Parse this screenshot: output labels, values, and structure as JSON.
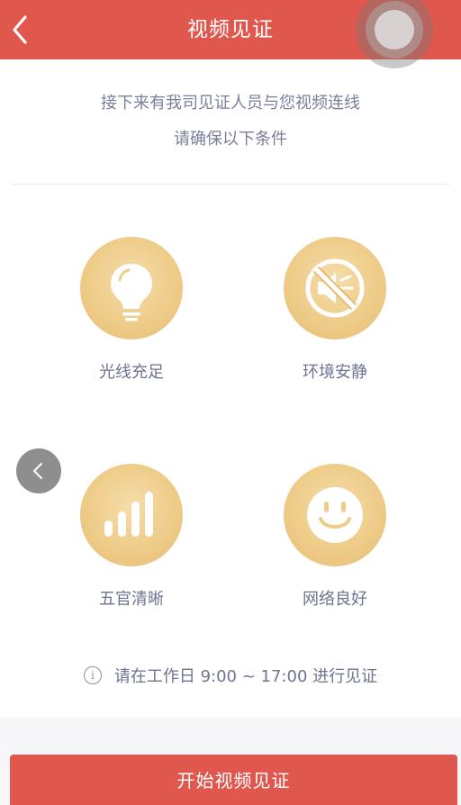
{
  "header": {
    "title": "视频见证"
  },
  "intro": {
    "line1": "接下来有我司见证人员与您视频连线",
    "line2": "请确保以下条件"
  },
  "conditions": [
    {
      "label": "光线充足",
      "icon": "lightbulb-icon"
    },
    {
      "label": "环境安静",
      "icon": "mute-icon"
    },
    {
      "label": "五官清晰",
      "icon": "signal-bars-icon"
    },
    {
      "label": "网络良好",
      "icon": "smiley-icon"
    }
  ],
  "notice": {
    "text": "请在工作日 9:00 ~ 17:00 进行见证",
    "icon": "info-icon"
  },
  "footer": {
    "button_label": "开始视频见证"
  },
  "colors": {
    "primary": "#e0574d",
    "gold": "#eecc89",
    "text_muted": "#6e7390"
  }
}
